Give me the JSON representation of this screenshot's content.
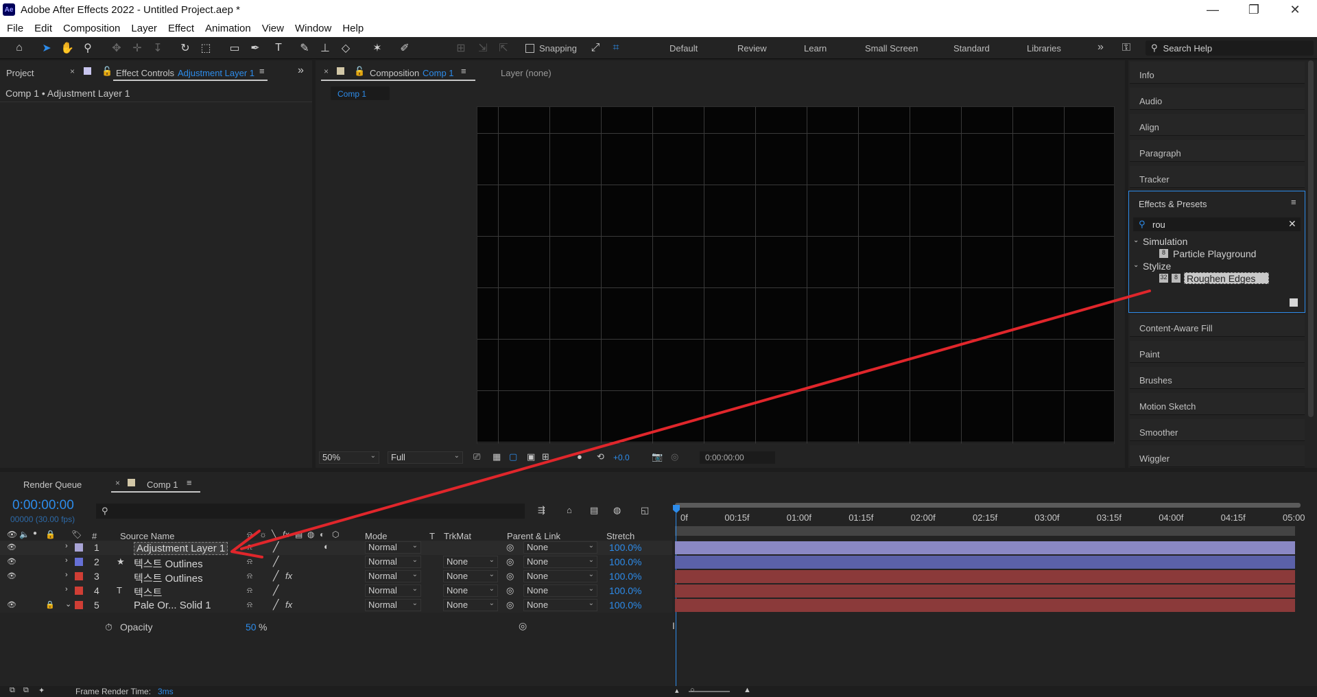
{
  "window": {
    "app_badge": "Ae",
    "title": "Adobe After Effects 2022 - Untitled Project.aep *",
    "minimize": "—",
    "maximize": "❐",
    "close": "✕"
  },
  "menu": [
    "File",
    "Edit",
    "Composition",
    "Layer",
    "Effect",
    "Animation",
    "View",
    "Window",
    "Help"
  ],
  "toolbar": {
    "snapping_label": "Snapping",
    "workspaces": [
      "Default",
      "Review",
      "Learn",
      "Small Screen",
      "Standard",
      "Libraries"
    ],
    "more": "»",
    "search_placeholder": "Search Help"
  },
  "left_panel": {
    "tab_project": "Project",
    "tab_effect_controls": "Effect Controls",
    "tab_effect_controls_layer": "Adjustment Layer 1",
    "breadcrumb": "Comp 1 • Adjustment Layer 1"
  },
  "comp_panel": {
    "tab_label": "Composition",
    "tab_comp_name": "Comp 1",
    "layer_tab": "Layer (none)",
    "sub_tab": "Comp 1",
    "zoom": "50%",
    "resolution": "Full",
    "exposure": "+0.0",
    "timecode": "0:00:00:00"
  },
  "right_panel": {
    "items_top": [
      "Info",
      "Audio",
      "Align",
      "Paragraph",
      "Tracker"
    ],
    "effects_presets_title": "Effects & Presets",
    "search_value": "rou",
    "groups": [
      {
        "name": "Simulation",
        "items": [
          "Particle Playground"
        ]
      },
      {
        "name": "Stylize",
        "items": [
          "Roughen Edges"
        ]
      }
    ],
    "items_bottom": [
      "Content-Aware Fill",
      "Paint",
      "Brushes",
      "Motion Sketch",
      "Smoother",
      "Wiggler"
    ]
  },
  "timeline": {
    "tab_render_queue": "Render Queue",
    "tab_comp": "Comp 1",
    "current_time": "0:00:00:00",
    "fps_info": "00000 (30.00 fps)",
    "columns": {
      "num": "#",
      "source_name": "Source Name",
      "mode": "Mode",
      "t": "T",
      "trkmat": "TrkMat",
      "parent": "Parent & Link",
      "stretch": "Stretch"
    },
    "ruler_labels": [
      "0f",
      "00:15f",
      "01:00f",
      "01:15f",
      "02:00f",
      "02:15f",
      "03:00f",
      "03:15f",
      "04:00f",
      "04:15f",
      "05:00"
    ],
    "layers": [
      {
        "num": "1",
        "name": "Adjustment Layer 1",
        "mode": "Normal",
        "trkmat": "",
        "parent": "None",
        "stretch": "100.0%",
        "label_color": "#a9a4d6",
        "type_icon": "",
        "bar_color": "#8a88c4"
      },
      {
        "num": "2",
        "name": "텍스트 Outlines",
        "mode": "Normal",
        "trkmat": "None",
        "parent": "None",
        "stretch": "100.0%",
        "label_color": "#6670d6",
        "type_icon": "★",
        "bar_color": "#5b61a8"
      },
      {
        "num": "3",
        "name": "텍스트 Outlines",
        "mode": "Normal",
        "trkmat": "None",
        "parent": "None",
        "stretch": "100.0%",
        "label_color": "#d03e35",
        "type_icon": "",
        "bar_color": "#8b3a3a"
      },
      {
        "num": "4",
        "name": "텍스트",
        "mode": "Normal",
        "trkmat": "None",
        "parent": "None",
        "stretch": "100.0%",
        "label_color": "#d03e35",
        "type_icon": "T",
        "bar_color": "#8b3a3a"
      },
      {
        "num": "5",
        "name": "Pale Or... Solid 1",
        "mode": "Normal",
        "trkmat": "None",
        "parent": "None",
        "stretch": "100.0%",
        "label_color": "#d03e35",
        "type_icon": "",
        "bar_color": "#8b3a3a"
      }
    ],
    "opacity_label": "Opacity",
    "opacity_value": "50",
    "opacity_unit": "%",
    "frame_render_label": "Frame Render Time:",
    "frame_render_value": "3ms"
  },
  "colors": {
    "accent_blue": "#2d8ceb",
    "annotation_arrow": "#e0262b"
  }
}
